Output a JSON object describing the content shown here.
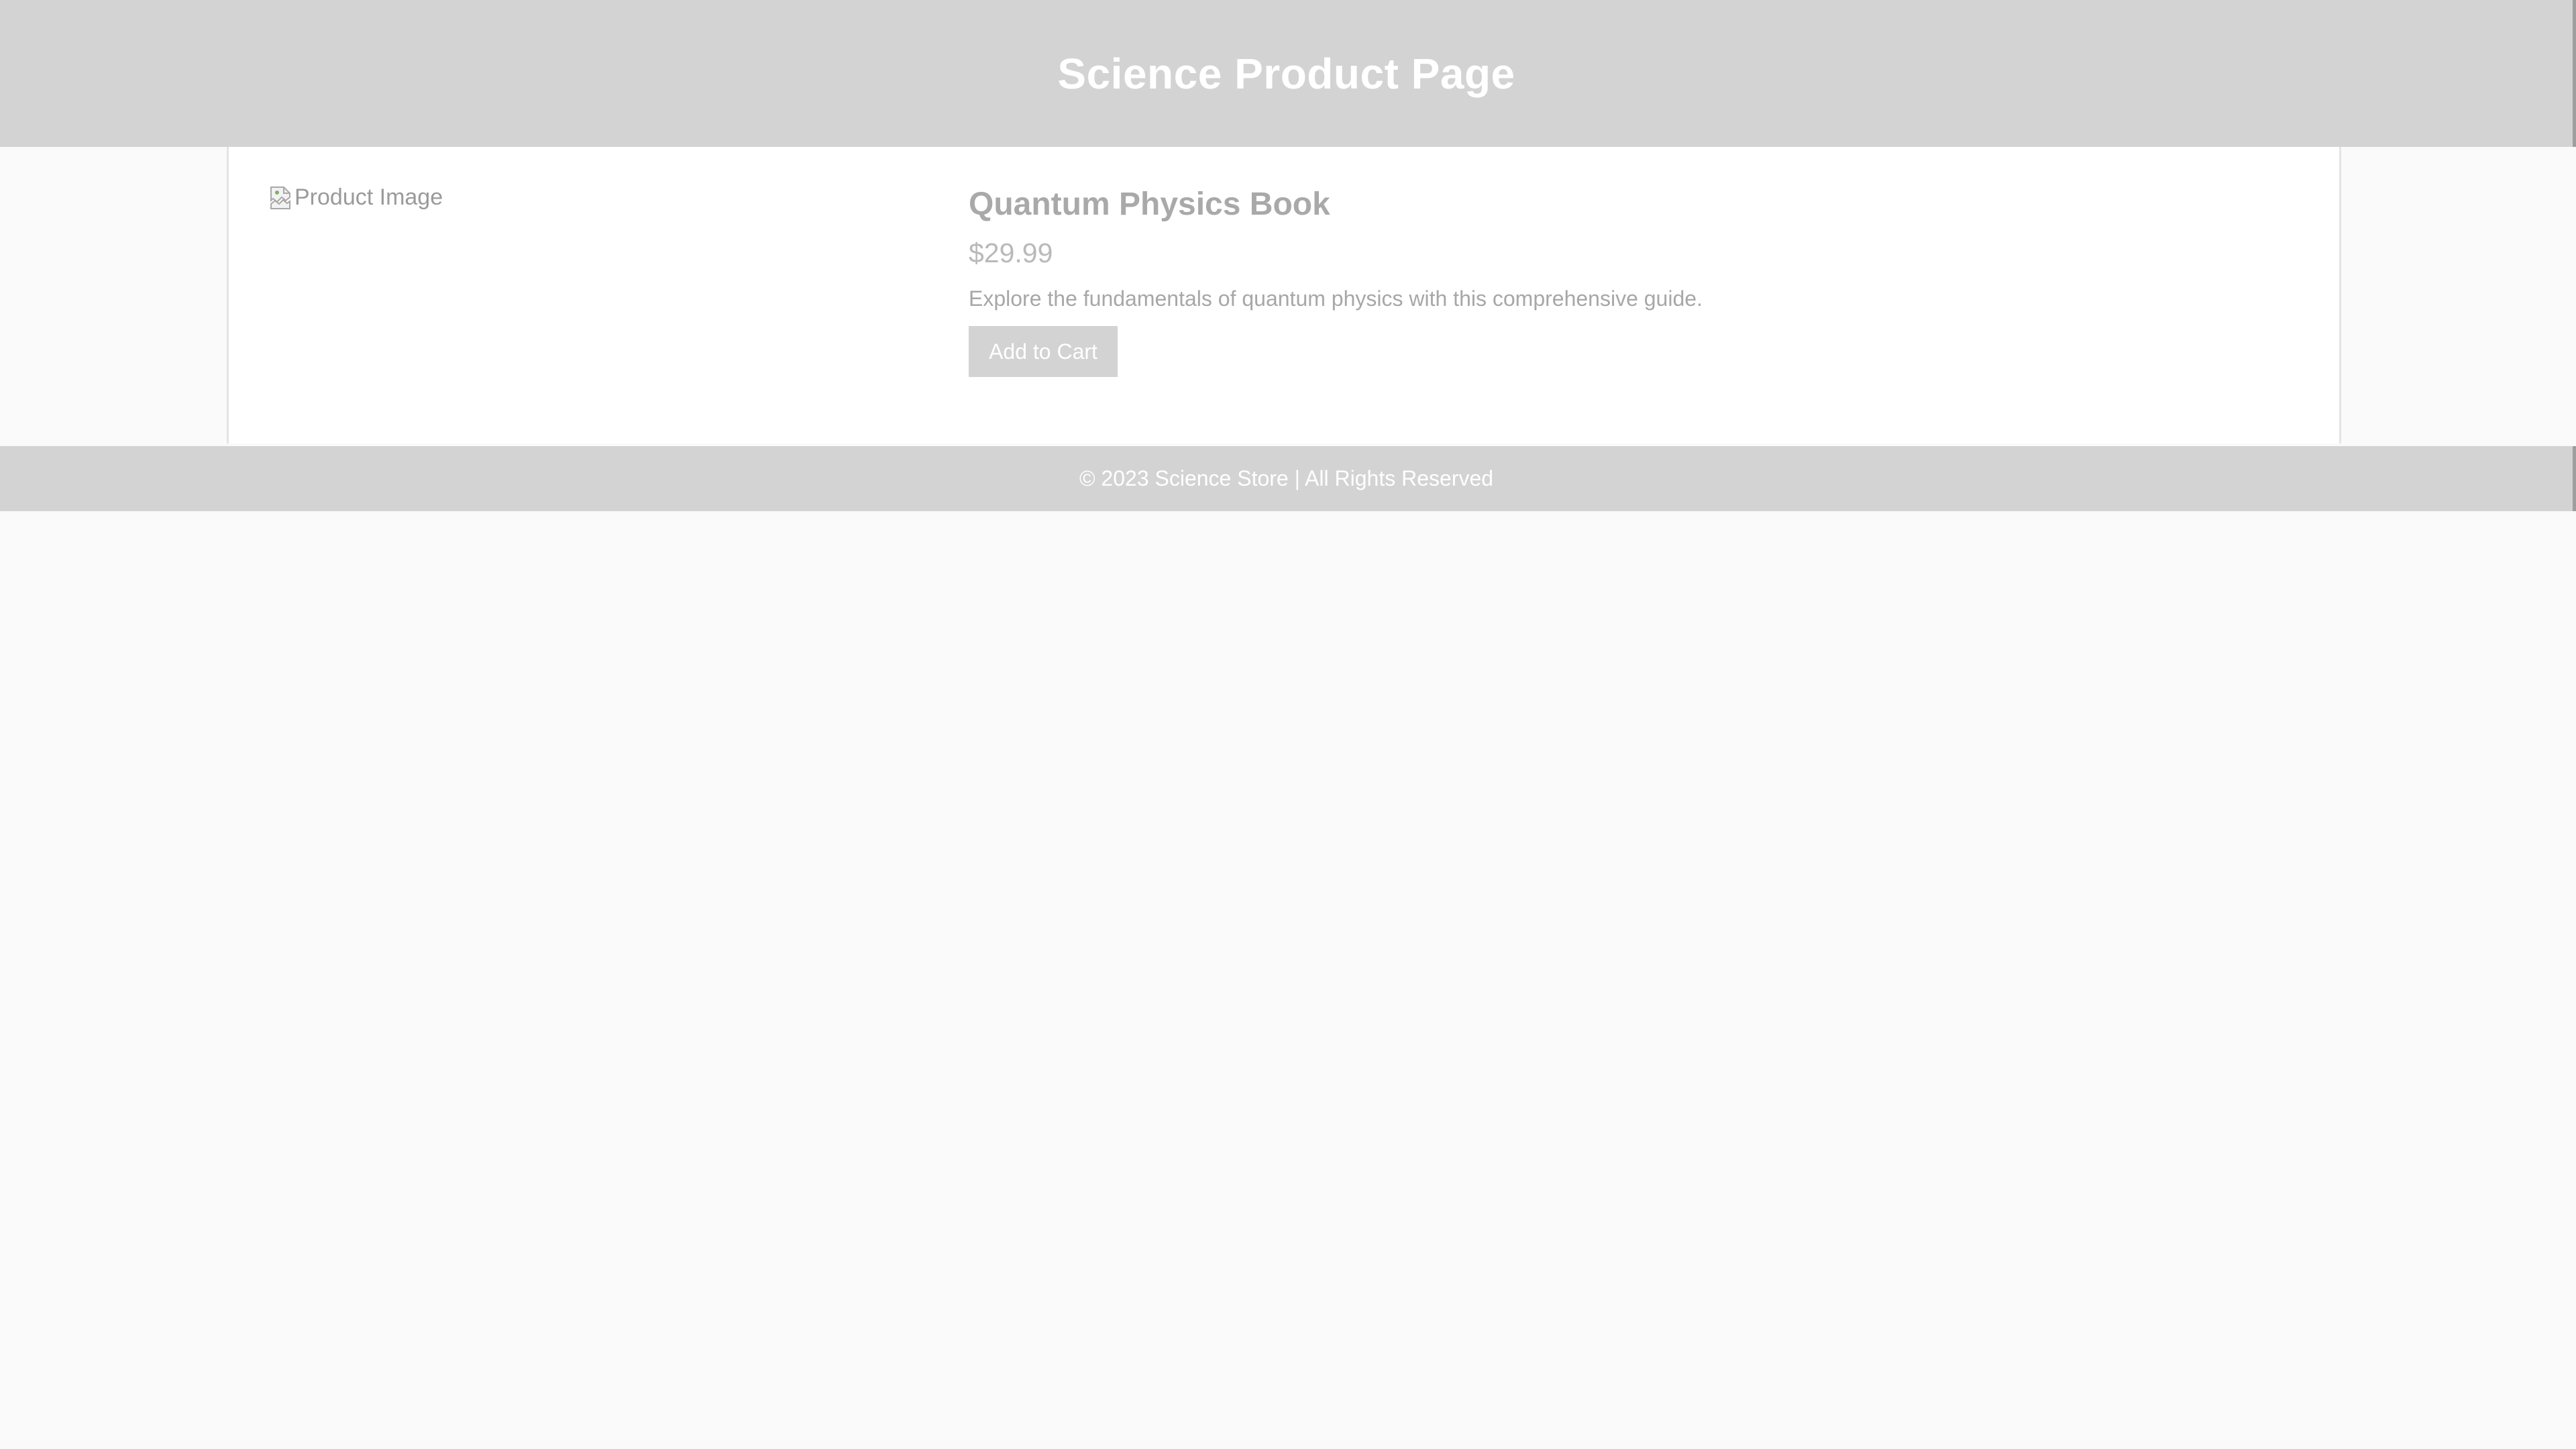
{
  "header": {
    "title": "Science Product Page"
  },
  "product": {
    "image_alt": "Product Image",
    "name": "Quantum Physics Book",
    "price": "$29.99",
    "description": "Explore the fundamentals of quantum physics with this comprehensive guide.",
    "add_to_cart_label": "Add to Cart"
  },
  "footer": {
    "text": "© 2023 Science Store | All Rights Reserved"
  },
  "colors": {
    "header_bg": "#d3d3d3",
    "footer_bg": "#d3d3d3",
    "button_bg": "#d3d3d3",
    "page_bg": "#fafafa"
  },
  "icons": {
    "broken_image": "broken-image-icon"
  }
}
